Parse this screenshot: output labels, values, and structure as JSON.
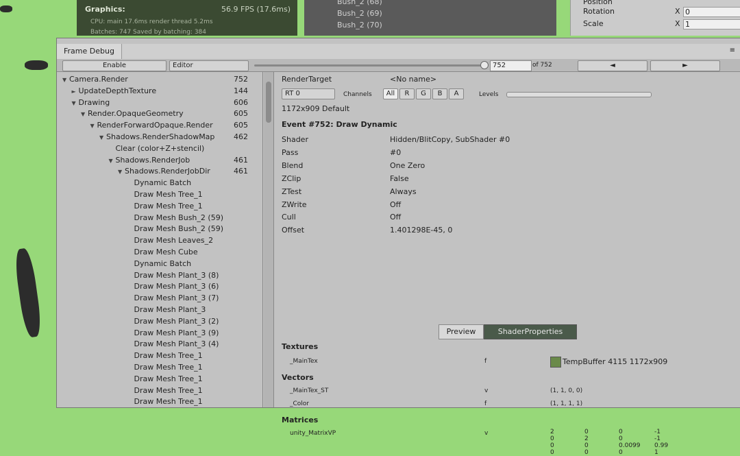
{
  "background": {
    "stats": {
      "title": "Graphics:",
      "fps": "56.9 FPS (17.6ms)",
      "cpu": "CPU: main 17.6ms  render thread 5.2ms",
      "batches": "Batches: 747    Saved by batching: 384"
    },
    "hierarchy": [
      "Bush_2 (68)",
      "Bush_2 (69)",
      "Bush_2 (70)"
    ],
    "inspector": [
      {
        "label": "Position",
        "axis": "X",
        "value": ""
      },
      {
        "label": "Rotation",
        "axis": "X",
        "value": "0"
      },
      {
        "label": "Scale",
        "axis": "X",
        "value": "1"
      }
    ]
  },
  "window": {
    "tab": "Frame Debug",
    "menu": "≡"
  },
  "toolbar": {
    "enable": "Enable",
    "target": "Editor",
    "event_value": "752",
    "of_label": "of 752",
    "prev": "◄",
    "next": "►"
  },
  "tree": [
    {
      "label": "Camera.Render",
      "count": "752",
      "indent": 0,
      "arrow": "▼"
    },
    {
      "label": "UpdateDepthTexture",
      "count": "144",
      "indent": 1,
      "arrow": "►"
    },
    {
      "label": "Drawing",
      "count": "606",
      "indent": 1,
      "arrow": "▼"
    },
    {
      "label": "Render.OpaqueGeometry",
      "count": "605",
      "indent": 2,
      "arrow": "▼"
    },
    {
      "label": "RenderForwardOpaque.Render",
      "count": "605",
      "indent": 3,
      "arrow": "▼"
    },
    {
      "label": "Shadows.RenderShadowMap",
      "count": "462",
      "indent": 4,
      "arrow": "▼"
    },
    {
      "label": "Clear (color+Z+stencil)",
      "count": "",
      "indent": 5,
      "arrow": ""
    },
    {
      "label": "Shadows.RenderJob",
      "count": "461",
      "indent": 5,
      "arrow": "▼"
    },
    {
      "label": "Shadows.RenderJobDir",
      "count": "461",
      "indent": 6,
      "arrow": "▼"
    },
    {
      "label": "Dynamic Batch",
      "count": "",
      "indent": 7,
      "arrow": ""
    },
    {
      "label": "Draw Mesh Tree_1",
      "count": "",
      "indent": 7,
      "arrow": ""
    },
    {
      "label": "Draw Mesh Tree_1",
      "count": "",
      "indent": 7,
      "arrow": ""
    },
    {
      "label": "Draw Mesh Bush_2 (59)",
      "count": "",
      "indent": 7,
      "arrow": ""
    },
    {
      "label": "Draw Mesh Bush_2 (59)",
      "count": "",
      "indent": 7,
      "arrow": ""
    },
    {
      "label": "Draw Mesh Leaves_2",
      "count": "",
      "indent": 7,
      "arrow": ""
    },
    {
      "label": "Draw Mesh Cube",
      "count": "",
      "indent": 7,
      "arrow": ""
    },
    {
      "label": "Dynamic Batch",
      "count": "",
      "indent": 7,
      "arrow": ""
    },
    {
      "label": "Draw Mesh Plant_3 (8)",
      "count": "",
      "indent": 7,
      "arrow": ""
    },
    {
      "label": "Draw Mesh Plant_3 (6)",
      "count": "",
      "indent": 7,
      "arrow": ""
    },
    {
      "label": "Draw Mesh Plant_3 (7)",
      "count": "",
      "indent": 7,
      "arrow": ""
    },
    {
      "label": "Draw Mesh Plant_3",
      "count": "",
      "indent": 7,
      "arrow": ""
    },
    {
      "label": "Draw Mesh Plant_3 (2)",
      "count": "",
      "indent": 7,
      "arrow": ""
    },
    {
      "label": "Draw Mesh Plant_3 (9)",
      "count": "",
      "indent": 7,
      "arrow": ""
    },
    {
      "label": "Draw Mesh Plant_3 (4)",
      "count": "",
      "indent": 7,
      "arrow": ""
    },
    {
      "label": "Draw Mesh Tree_1",
      "count": "",
      "indent": 7,
      "arrow": ""
    },
    {
      "label": "Draw Mesh Tree_1",
      "count": "",
      "indent": 7,
      "arrow": ""
    },
    {
      "label": "Draw Mesh Tree_1",
      "count": "",
      "indent": 7,
      "arrow": ""
    },
    {
      "label": "Draw Mesh Tree_1",
      "count": "",
      "indent": 7,
      "arrow": ""
    },
    {
      "label": "Draw Mesh Tree_1",
      "count": "",
      "indent": 7,
      "arrow": ""
    }
  ],
  "details": {
    "render_target_label": "RenderTarget",
    "render_target_value": "<No name>",
    "rt_select": "RT 0",
    "channels_label": "Channels",
    "channels": [
      "All",
      "R",
      "G",
      "B",
      "A"
    ],
    "levels_label": "Levels",
    "resolution": "1172x909 Default",
    "event_title": "Event #752: Draw Dynamic",
    "props": [
      {
        "key": "Shader",
        "value": "Hidden/BlitCopy, SubShader #0"
      },
      {
        "key": "Pass",
        "value": "#0"
      },
      {
        "key": "Blend",
        "value": "One Zero"
      },
      {
        "key": "ZClip",
        "value": "False"
      },
      {
        "key": "ZTest",
        "value": "Always"
      },
      {
        "key": "ZWrite",
        "value": "Off"
      },
      {
        "key": "Cull",
        "value": "Off"
      },
      {
        "key": "Offset",
        "value": "1.401298E-45, 0"
      }
    ],
    "tab_preview": "Preview",
    "tab_shader_props": "ShaderProperties",
    "textures_header": "Textures",
    "tex_name": "_MainTex",
    "tex_stage": "f",
    "tex_value": "TempBuffer 4115 1172x909",
    "vectors_header": "Vectors",
    "vectors": [
      {
        "name": "_MainTex_ST",
        "stage": "v",
        "value": "(1, 1, 0, 0)"
      },
      {
        "name": "_Color",
        "stage": "f",
        "value": "(1, 1, 1, 1)"
      }
    ],
    "matrices_header": "Matrices",
    "matrix_name": "unity_MatrixVP",
    "matrix_stage": "v",
    "matrix": [
      [
        "2",
        "0",
        "0",
        "-1"
      ],
      [
        "0",
        "2",
        "0",
        "-1"
      ],
      [
        "0",
        "0",
        "0.0099",
        "0.99"
      ],
      [
        "0",
        "0",
        "0",
        "1"
      ]
    ]
  }
}
